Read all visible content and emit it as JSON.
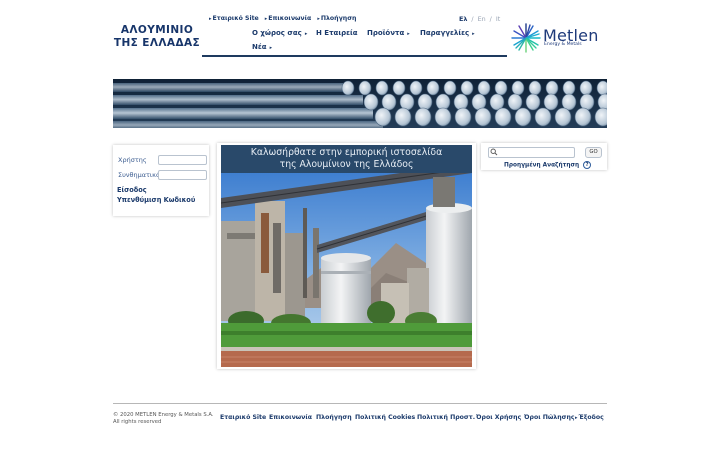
{
  "brand": {
    "line1": "ΑΛΟΥΜΙΝΙΟ",
    "line2": "ΤΗΣ ΕΛΛΑΔΑΣ"
  },
  "top_links": [
    "Εταιρικό Site",
    "Επικοινωνία",
    "Πλοήγηση"
  ],
  "languages": {
    "el": "Ελ",
    "en": "En",
    "it": "It"
  },
  "menu": {
    "your_space": "Ο χώρος σας",
    "company": "Η Εταιρεία",
    "products": "Προϊόντα",
    "orders": "Παραγγελίες",
    "news": "Νέα"
  },
  "logo": {
    "name": "Metlen",
    "tagline": "Energy & Metals"
  },
  "login": {
    "user_label": "Χρήστης",
    "password_label": "Συνθηματικό",
    "login_link": "Είσοδος",
    "reminder_link": "Υπενθύμιση Κωδικού"
  },
  "welcome": {
    "line1": "Καλωσήρθατε στην εμπορική ιστοσελίδα",
    "line2": "της Αλουμίνιον της Ελλάδος"
  },
  "search": {
    "go_label": "GO",
    "advanced_label": "Προηγμένη Αναζήτηση",
    "help_icon": "?"
  },
  "footer": {
    "copyright": "© 2020 METLEN Energy & Metals S.A.",
    "rights": "All rights reserved",
    "links": {
      "corporate": "Εταιρικό Site",
      "contact": "Επικοινωνία",
      "navigation": "Πλοήγηση",
      "cookies": "Πολιτική Cookies",
      "privacy": "Πολιτική Προστ.",
      "terms": "Όροι Χρήσης",
      "sales": "Όροι Πώλησης",
      "logout": "Έξοδος"
    }
  },
  "colors": {
    "navy": "#1b3a6b",
    "welcome_bg": "#29496a",
    "logo_blue": "#1e3a7a"
  }
}
